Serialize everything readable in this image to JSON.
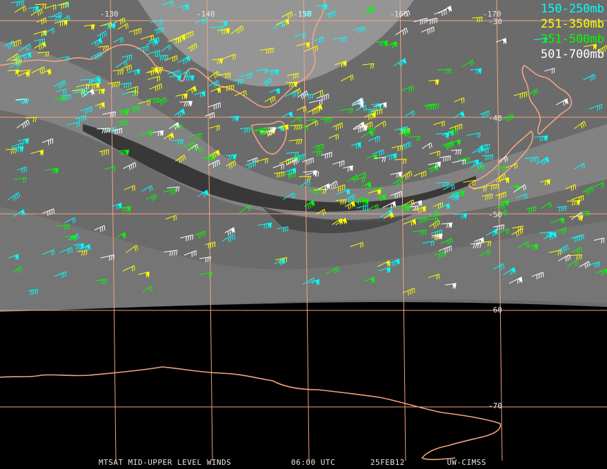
{
  "legend": [
    {
      "label": "150-250mb",
      "color": "#00ffff"
    },
    {
      "label": "251-350mb",
      "color": "#ffff00"
    },
    {
      "label": "351-500mb",
      "color": "#00ff00"
    },
    {
      "label": "501-700mb",
      "color": "#ffffff"
    }
  ],
  "lon_labels": [
    "-130",
    "-140",
    "-150",
    "-160",
    "-170"
  ],
  "lat_labels": [
    "-30",
    "-40",
    "-50",
    "-60",
    "-70"
  ],
  "footer": {
    "product": "MTSAT MID-UPPER LEVEL WINDS",
    "time": "06:00 UTC",
    "date": "25FEB12",
    "source": "UW-CIMSS"
  },
  "colors": {
    "grid": "#f4a582",
    "coast": "#f4a582",
    "space": "#000000"
  }
}
